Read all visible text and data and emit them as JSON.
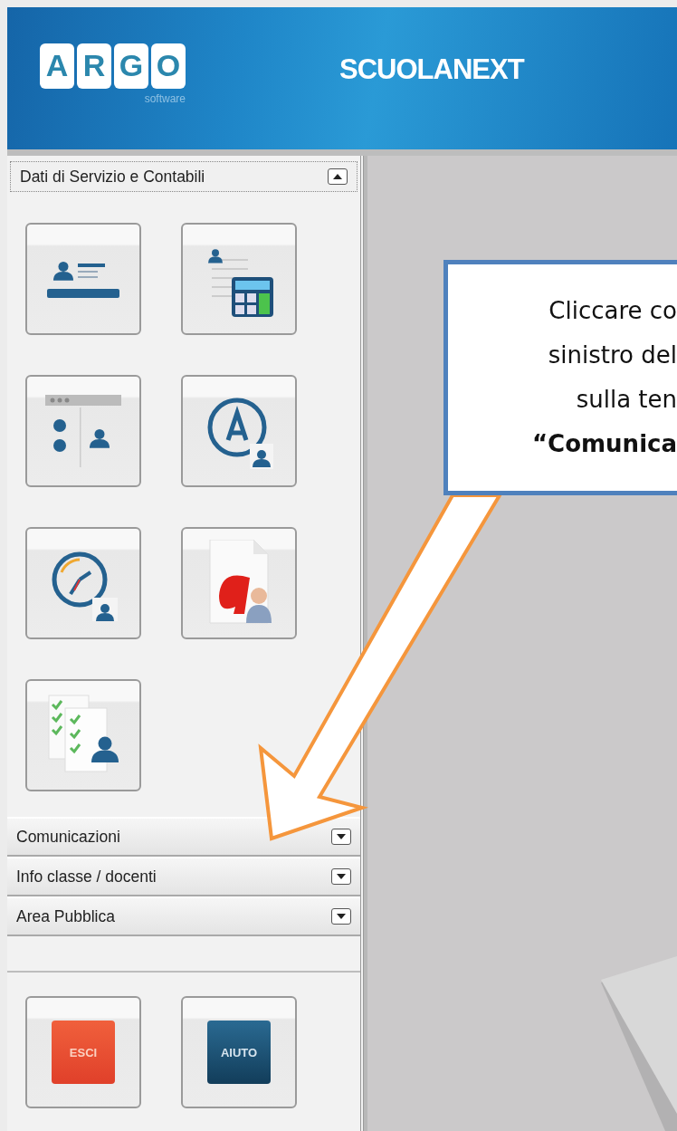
{
  "header": {
    "logo_letters": [
      "A",
      "R",
      "G",
      "O"
    ],
    "logo_subtitle": "software",
    "app_name": "SCUOLANEXT"
  },
  "sidebar": {
    "sections": [
      {
        "title": "Dati di Servizio e Contabili",
        "expanded": true,
        "tiles": [
          {
            "kind": "card"
          },
          {
            "kind": "calculator"
          },
          {
            "kind": "panel"
          },
          {
            "kind": "letter"
          },
          {
            "kind": "clock"
          },
          {
            "kind": "document"
          },
          {
            "kind": "checklist"
          }
        ]
      },
      {
        "title": "Comunicazioni",
        "expanded": false
      },
      {
        "title": "Info classe / docenti",
        "expanded": false
      },
      {
        "title": "Area Pubblica",
        "expanded": false
      }
    ],
    "bottom_buttons": [
      {
        "label": "ESCI",
        "kind": "exit"
      },
      {
        "label": "AIUTO",
        "kind": "help"
      }
    ]
  },
  "callout": {
    "lines": [
      {
        "text": "Cliccare co",
        "bold": false
      },
      {
        "text": "sinistro del",
        "bold": false
      },
      {
        "text": "sulla ten",
        "bold": false
      },
      {
        "text": "“Comunica",
        "bold": true
      }
    ]
  }
}
